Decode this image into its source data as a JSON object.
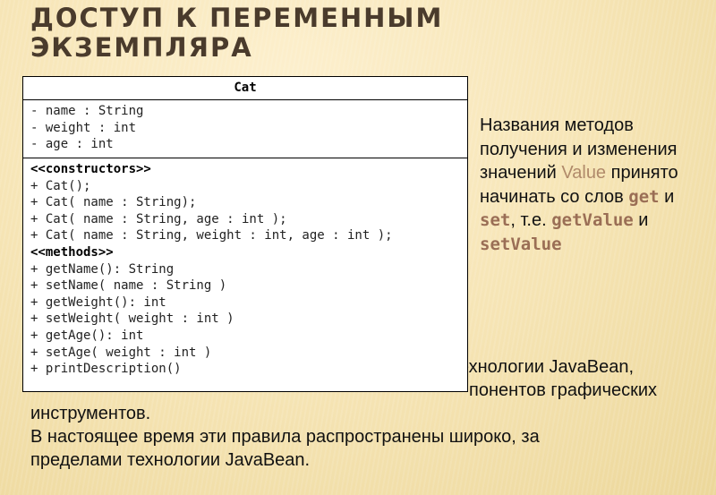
{
  "slide": {
    "title_line1": "ДОСТУП К ПЕРЕМЕННЫМ",
    "title_line2": "ЭКЗЕМПЛЯРА"
  },
  "uml": {
    "class_name": "Cat",
    "attributes": [
      "- name : String",
      "- weight : int",
      "- age : int"
    ],
    "constructors_stereotype": "<<constructors>>",
    "constructors": [
      "+ Cat();",
      "+ Cat( name : String);",
      "+ Cat( name : String, age : int );",
      "+ Cat( name : String, weight : int, age : int );"
    ],
    "methods_stereotype": "<<methods>>",
    "methods": [
      "+ getName(): String",
      "+ setName( name : String )",
      "+ getWeight(): int",
      "+ setWeight( weight : int )",
      "+ getAge(): int",
      "+ setAge( weight : int )",
      "+ printDescription()"
    ]
  },
  "side_note": {
    "part1": "Названия методов получения и изменения значений ",
    "value_word": "Value",
    "part2": " принято начинать со слов ",
    "get": "get",
    "part3": " и ",
    "set": "set",
    "part4": ", т.е. ",
    "getValue": "getValue",
    "part5": " и ",
    "setValue": "setValue"
  },
  "body": {
    "line1_visible": "технологии JavaBean,",
    "line2_visible": "понентов графических",
    "line3": "инструментов.",
    "line4": "В настоящее время эти правила распространены широко, за",
    "line5": "пределами технологии JavaBean."
  }
}
